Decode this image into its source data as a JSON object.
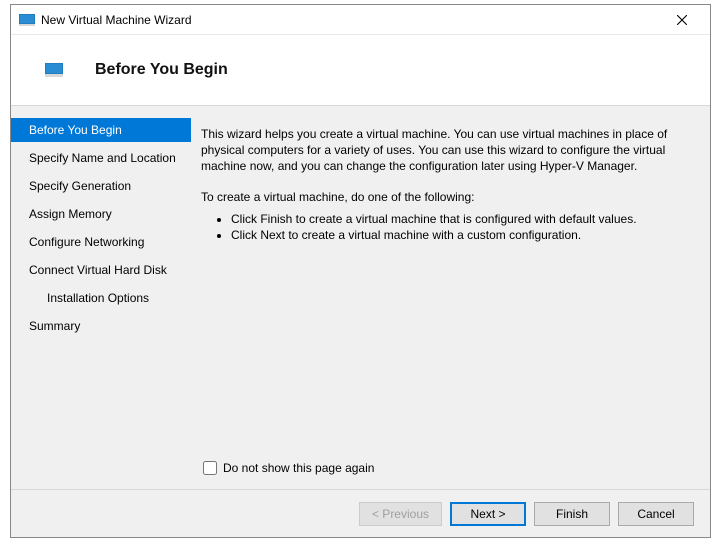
{
  "window": {
    "title": "New Virtual Machine Wizard"
  },
  "header": {
    "heading": "Before You Begin"
  },
  "sidebar": {
    "items": [
      {
        "label": "Before You Begin",
        "active": true
      },
      {
        "label": "Specify Name and Location"
      },
      {
        "label": "Specify Generation"
      },
      {
        "label": "Assign Memory"
      },
      {
        "label": "Configure Networking"
      },
      {
        "label": "Connect Virtual Hard Disk"
      },
      {
        "label": "Installation Options",
        "child": true
      },
      {
        "label": "Summary"
      }
    ]
  },
  "content": {
    "intro": "This wizard helps you create a virtual machine. You can use virtual machines in place of physical computers for a variety of uses. You can use this wizard to configure the virtual machine now, and you can change the configuration later using Hyper-V Manager.",
    "create_prompt": "To create a virtual machine, do one of the following:",
    "bullets": [
      "Click Finish to create a virtual machine that is configured with default values.",
      "Click Next to create a virtual machine with a custom configuration."
    ],
    "checkbox_label": "Do not show this page again"
  },
  "footer": {
    "previous": "< Previous",
    "next": "Next >",
    "finish": "Finish",
    "cancel": "Cancel"
  }
}
